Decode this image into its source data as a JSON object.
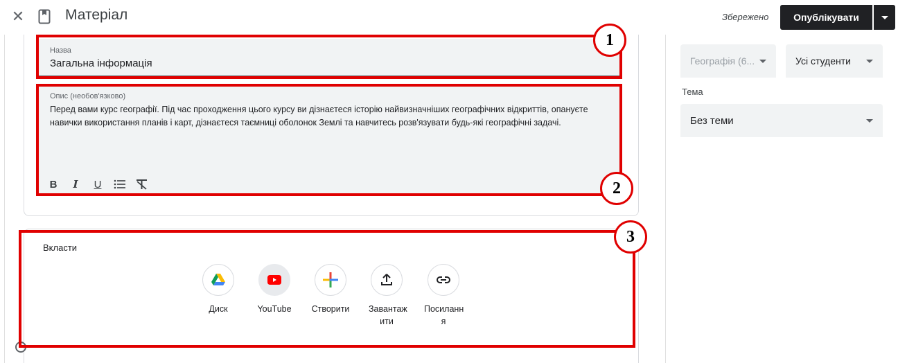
{
  "header": {
    "close_icon": "close-icon",
    "page_icon": "bookmark-icon",
    "title": "Матеріал",
    "saved_status": "Збережено",
    "publish_label": "Опублікувати"
  },
  "form": {
    "name_label": "Назва",
    "name_value": "Загальна інформація",
    "description_label": "Опис (необов'язково)",
    "description_value": "Перед вами курс географії. Під час проходження цього курсу ви дізнаєтеся історію найвизначніших географічних відкриттів, опануєте навички використання планів і карт, дізнаєтеся таємниці оболонок Землі та навчитесь розв'язувати будь-які географічні задачі.",
    "toolbar": [
      "bold-icon",
      "italic-icon",
      "underline-icon",
      "bulleted-list-icon",
      "clear-formatting-icon"
    ]
  },
  "attach": {
    "title": "Вкласти",
    "items": [
      {
        "label": "Диск",
        "icon": "google-drive-icon"
      },
      {
        "label": "YouTube",
        "icon": "youtube-icon"
      },
      {
        "label": "Створити",
        "icon": "plus-icon"
      },
      {
        "label": "Завантаж ити",
        "icon": "upload-icon"
      },
      {
        "label": "Посиланн я",
        "icon": "link-icon"
      }
    ]
  },
  "sidebar": {
    "class_select": "Географія (6...",
    "students_select": "Усі студенти",
    "topic_label": "Тема",
    "topic_value": "Без теми"
  },
  "annotations": [
    "1",
    "2",
    "3"
  ],
  "colors": {
    "annotation": "#e00000",
    "publish_bg": "#202124",
    "field_bg": "#f1f3f4"
  }
}
